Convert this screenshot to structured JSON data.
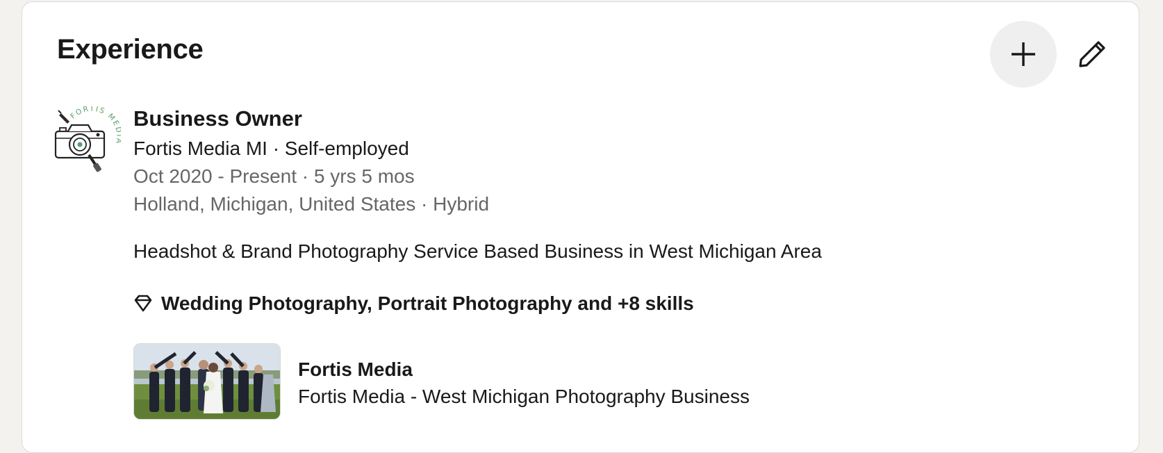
{
  "section": {
    "title": "Experience",
    "add_icon": "plus-icon",
    "edit_icon": "pencil-icon"
  },
  "experience": [
    {
      "logo_text": "FORTIS MEDIA",
      "title": "Business Owner",
      "company_line": "Fortis Media MI · Self-employed",
      "dates": "Oct 2020 - Present · 5 yrs 5 mos",
      "location": "Holland, Michigan, United States · Hybrid",
      "description": "Headshot & Brand Photography Service Based Business in West Michigan Area",
      "skills_icon": "diamond-icon",
      "skills": "Wedding Photography, Portrait Photography and +8 skills",
      "media": {
        "title": "Fortis Media",
        "subtitle": "Fortis Media - West Michigan Photography Business"
      }
    }
  ],
  "colors": {
    "page_bg": "#f4f2ee",
    "card_bg": "#ffffff",
    "text": "#191919",
    "muted_text": "#666666",
    "logo_green": "#5a9e6a",
    "add_button_bg": "#efefef"
  }
}
